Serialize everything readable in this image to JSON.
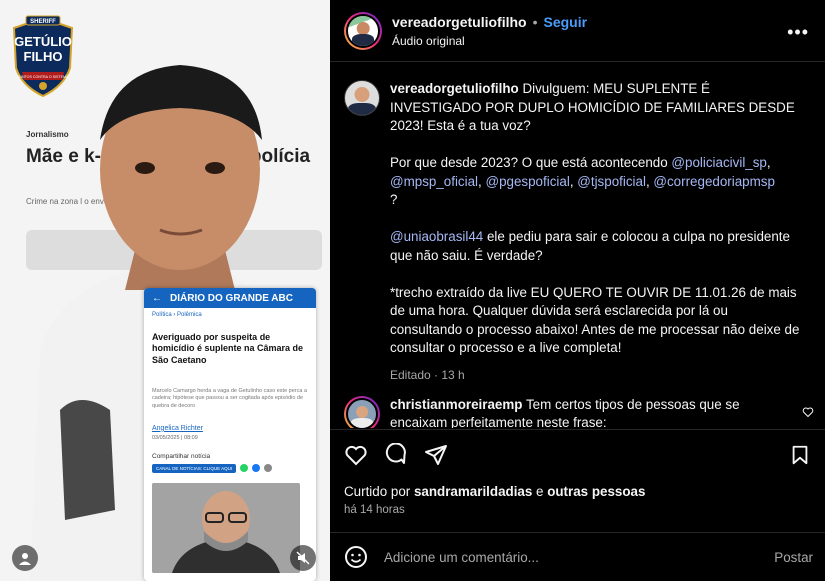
{
  "media": {
    "logo": {
      "top": "SHERIFF",
      "line1": "GETÚLIO",
      "line2": "FILHO",
      "band": "JUNTOS CONTRA O SISTEMA"
    },
    "bg_article": {
      "category": "Jornalismo",
      "headline": "Mãe e             k-sogro é suspe                   z polícia",
      "sub": "Crime na zona l                                       o envolveria guarda de criança"
    },
    "card": {
      "site": "DIÁRIO DO GRANDE ABC",
      "crumb": "Política  ›  Polêmica",
      "title": "Averiguado por suspeita de homicídio é suplente na Câmara de São Caetano",
      "lede": "Marcelo Camargo herda a vaga de Getulinho caso este perca a cadeira; hipótese que passou a ser cogitada após episódio de quebra de decoro",
      "author": "Angelica Richter",
      "date": "03/05/2025 | 08:09",
      "share_label": "Compartilhar notícia",
      "channel_label": "CANAL DE NOTÍCIAS: CLIQUE AQUI"
    }
  },
  "header": {
    "username": "vereadorgetuliofilho",
    "separator": "•",
    "follow_label": "Seguir",
    "audio_label": "Áudio original",
    "more_label": "•••"
  },
  "caption": {
    "username": "vereadorgetuliofilho",
    "p1_text": " Divulguem: MEU SUPLENTE É INVESTIGADO POR DUPLO HOMICÍDIO DE FAMILIARES DESDE 2023! Esta é a tua voz?",
    "p2_text": "Por que desde 2023? O que está acontecendo ",
    "mentions": [
      "@policiacivil_sp",
      "@mpsp_oficial",
      "@pgespoficial",
      "@tjspoficial",
      "@corregedoriapmsp"
    ],
    "p2_end": "?",
    "p3_mention": "@uniaobrasil44",
    "p3_text": " ele pediu para sair e colocou a culpa no presidente que não saiu. É verdade?",
    "p4_text": "*trecho extraído da live EU QUERO TE OUVIR DE 11.01.26 de mais de uma hora. Qualquer dúvida será esclarecida por lá ou consultando o processo abaixo! Antes de me processar não deixe de consultar o processo e a live completa!",
    "edited": "Editado · 13 h"
  },
  "comment": {
    "username": "christianmoreiraemp",
    "text": " Tem certos tipos de pessoas que se encaixam perfeitamente neste frase:"
  },
  "likes": {
    "prefix": "Curtido por ",
    "user": "sandramarildadias",
    "and": " e ",
    "others": "outras pessoas"
  },
  "time_ago": "há 14 horas",
  "add_comment": {
    "placeholder": "Adicione um comentário...",
    "post_label": "Postar"
  },
  "icons": [
    "heart-icon",
    "comment-icon",
    "share-icon",
    "bookmark-icon",
    "emoji-icon",
    "more-icon",
    "mute-icon",
    "user-icon"
  ]
}
